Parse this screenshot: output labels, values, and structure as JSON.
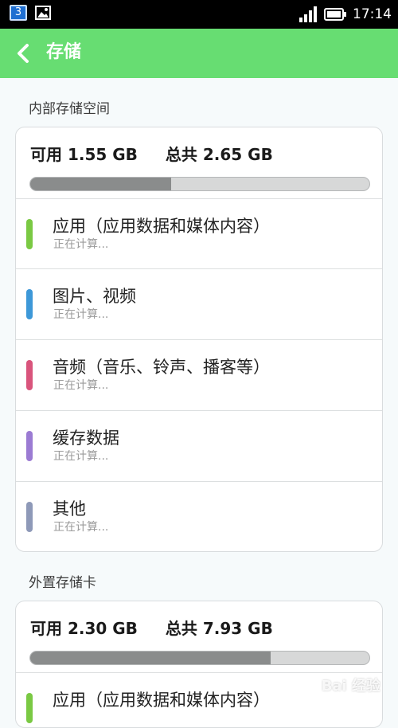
{
  "status_bar": {
    "notification_count": "3",
    "time": "17:14",
    "icons": [
      "notification-badge-icon",
      "image-icon",
      "signal-icon",
      "battery-icon"
    ]
  },
  "header": {
    "back_icon": "chevron-left-icon",
    "title": "存储"
  },
  "internal": {
    "section_title": "内部存储空间",
    "available": "可用 1.55 GB",
    "total": "总共 2.65 GB",
    "usage_fraction": 0.415,
    "items": [
      {
        "label": "应用（应用数据和媒体内容）",
        "status": "正在计算...",
        "color": "#7ac943"
      },
      {
        "label": "图片、视频",
        "status": "正在计算...",
        "color": "#3d98d8"
      },
      {
        "label": "音频（音乐、铃声、播客等）",
        "status": "正在计算...",
        "color": "#d9547c"
      },
      {
        "label": "缓存数据",
        "status": "正在计算...",
        "color": "#9b7bd3"
      },
      {
        "label": "其他",
        "status": "正在计算...",
        "color": "#8e99b8"
      }
    ]
  },
  "external": {
    "section_title": "外置存储卡",
    "available": "可用 2.30 GB",
    "total": "总共 7.93 GB",
    "usage_fraction": 0.71,
    "items": [
      {
        "label": "应用（应用数据和媒体内容）",
        "color": "#7ac943"
      }
    ]
  },
  "watermark": "Bai 经验"
}
